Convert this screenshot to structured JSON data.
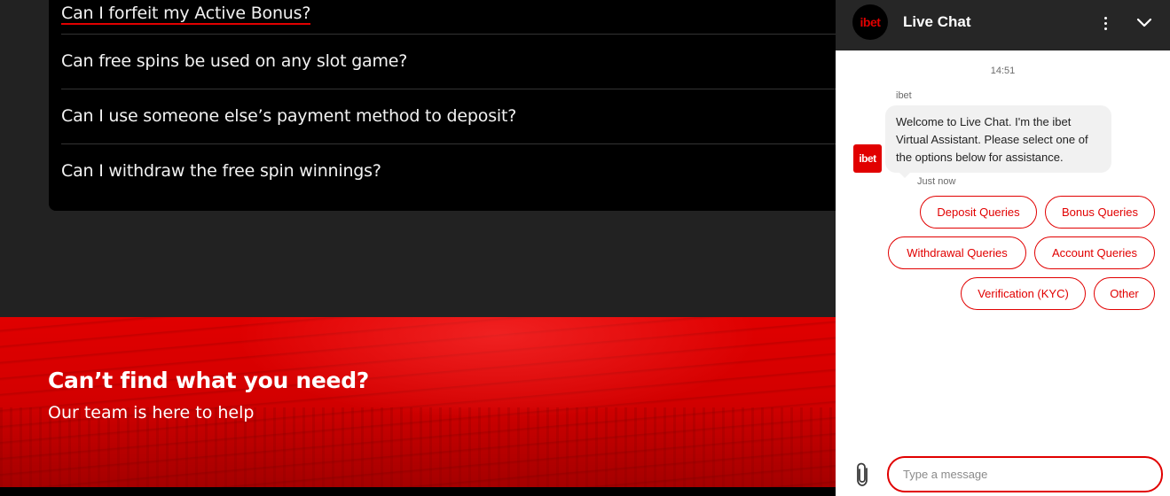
{
  "faq": {
    "items": [
      "Can I forfeit my Active Bonus?",
      "Can free spins be used on any slot game?",
      "Can I use someone else’s payment method to deposit?",
      "Can I withdraw the free spin winnings?"
    ]
  },
  "banner": {
    "title": "Can’t find what you need?",
    "subtitle": "Our team is here to help"
  },
  "chat": {
    "logo_text": "ibet",
    "title": "Live Chat",
    "timestamp": "14:51",
    "sender": "ibet",
    "avatar_text": "ibet",
    "message": "Welcome to Live Chat. I'm the ibet Virtual Assistant. Please select one of the options below for assistance.",
    "message_time": "Just now",
    "options": [
      "Deposit Queries",
      "Bonus Queries",
      "Withdrawal Queries",
      "Account Queries",
      "Verification (KYC)",
      "Other"
    ],
    "input_placeholder": "Type a message"
  },
  "colors": {
    "brand_red": "#e10000",
    "header_dark": "#262626",
    "page_bg": "#222222"
  }
}
